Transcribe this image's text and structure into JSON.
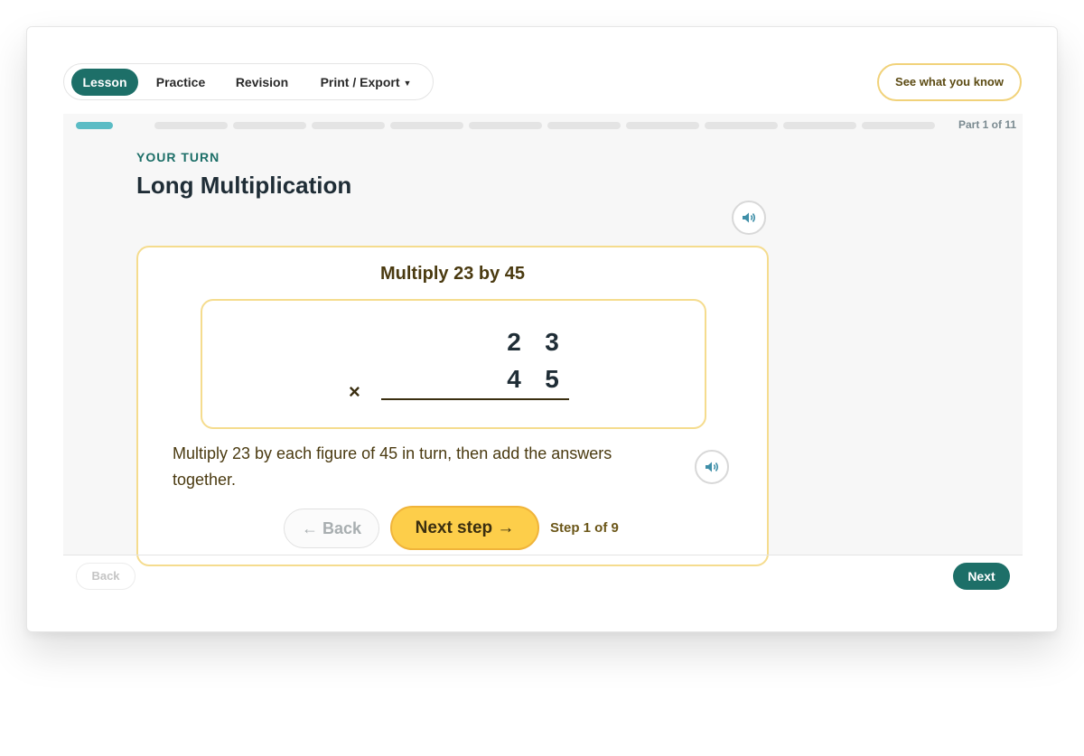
{
  "nav": {
    "tabs": [
      {
        "label": "Lesson",
        "active": true
      },
      {
        "label": "Practice",
        "active": false
      },
      {
        "label": "Revision",
        "active": false
      },
      {
        "label": "Print / Export",
        "active": false
      }
    ],
    "see_what_you_know": "See what you know"
  },
  "progress": {
    "current": 1,
    "total": 11,
    "label": "Part 1 of 11"
  },
  "lesson": {
    "kicker": "YOUR TURN",
    "title": "Long Multiplication",
    "question_title": "Multiply 23 by 45",
    "sum": {
      "top": [
        "2",
        "3"
      ],
      "bottom": [
        "4",
        "5"
      ],
      "operator": "×"
    },
    "instruction": "Multiply 23 by each figure of 45 in turn, then add the answers together.",
    "back_label": "← Back",
    "next_step_label": "Next step →",
    "step_label": "Step 1 of 9"
  },
  "footer": {
    "back_label": "Back",
    "next_label": "Next"
  },
  "icons": {
    "audio": "speaker-icon",
    "dropdown": "caret-down-icon"
  },
  "colors": {
    "primary": "#1d6f68",
    "accent": "#fdce4a",
    "progress_done": "#5bbcc5",
    "card_border": "#f5dc8e"
  }
}
